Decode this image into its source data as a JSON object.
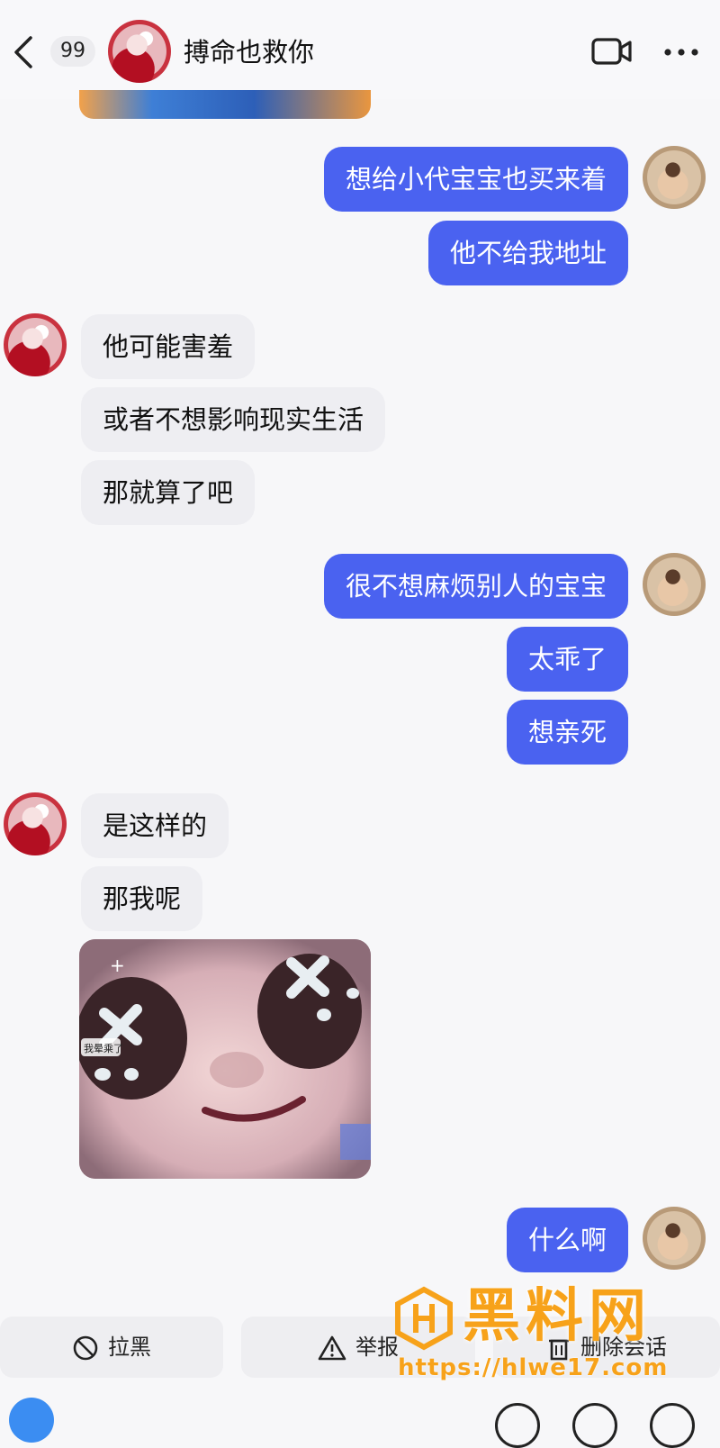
{
  "header": {
    "back_icon": "chevron-left-icon",
    "unread_count": "99",
    "contact_name": "搏命也救你",
    "video_icon": "video-call-icon",
    "more_icon": "more-dots-icon"
  },
  "messages": [
    {
      "side": "out",
      "text": "想给小代宝宝也买来着"
    },
    {
      "side": "out",
      "text": "他不给我地址"
    },
    {
      "side": "in",
      "text": "他可能害羞"
    },
    {
      "side": "in",
      "text": "或者不想影响现实生活"
    },
    {
      "side": "in",
      "text": "那就算了吧"
    },
    {
      "side": "out",
      "text": "很不想麻烦别人的宝宝"
    },
    {
      "side": "out",
      "text": "太乖了"
    },
    {
      "side": "out",
      "text": "想亲死"
    },
    {
      "side": "in",
      "text": "是这样的"
    },
    {
      "side": "in",
      "text": "那我呢"
    },
    {
      "side": "out",
      "text": "什么啊"
    }
  ],
  "sticker": {
    "caption": "我晕乘了",
    "plus": "+"
  },
  "actions": {
    "block_label": "拉黑",
    "report_label": "举报",
    "delete_label": "删除会话"
  },
  "watermark": {
    "text": "黑料网",
    "url": "https://hlwe17.com"
  },
  "colors": {
    "outgoing_bubble": "#4a62f0",
    "incoming_bubble": "#eeeef2",
    "watermark": "#f7a21a"
  }
}
